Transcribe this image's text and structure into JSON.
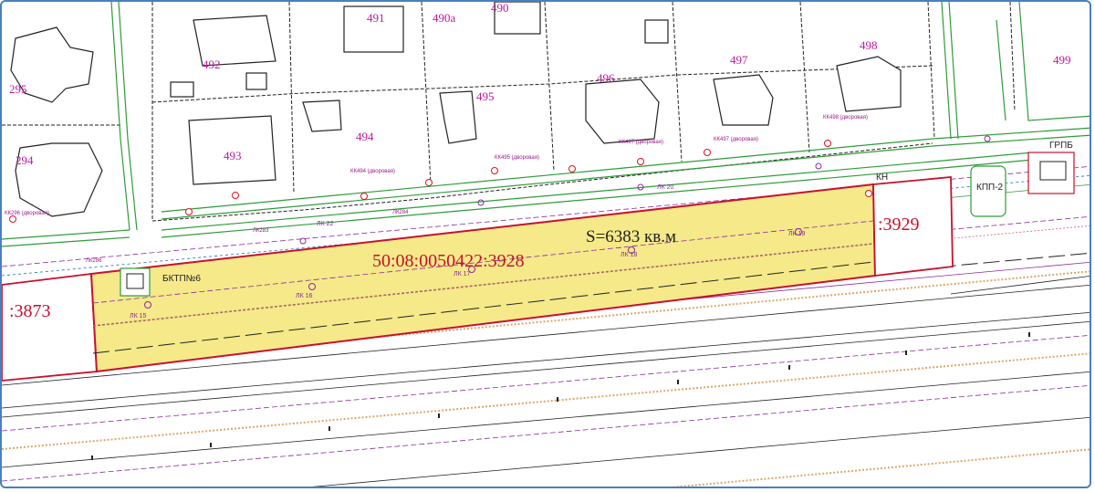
{
  "map": {
    "main_parcel": {
      "cadastral_number": "50:08:0050422:3928",
      "area": "S=6383 кв.м",
      "fill_color": "#f5e98a",
      "border_color": "#c8102e"
    },
    "neighbor_parcels": [
      {
        "label": ":3873"
      },
      {
        "label": ":3929"
      }
    ],
    "lot_numbers": [
      "491",
      "490а",
      "490",
      "492",
      "295",
      "499",
      "498",
      "497",
      "496",
      "495",
      "494",
      "493",
      "294"
    ],
    "structures": [
      "БКТП№6",
      "КПП-2",
      "ГРПБ",
      "КН"
    ],
    "wells": [
      "ЛК 15",
      "ЛК 16",
      "ЛК 17",
      "ЛК 18",
      "ЛК 19"
    ],
    "annotations": [
      "КК494 (дворовая)",
      "КК495 (дворовая)",
      "КК497 (дворовая)",
      "КК498 (дворовая)",
      "КК296 (дворовая)",
      "КК497 (дворовая)",
      "ЛК 22",
      "ЛК283",
      "ЛК284",
      "ЛК286",
      "ЛК 20"
    ],
    "colors": {
      "lot_number": "#c0179e",
      "parcel_border": "#c8102e",
      "road_edge": "#2e9b3a",
      "utility_line": "#8a2a9a"
    }
  }
}
